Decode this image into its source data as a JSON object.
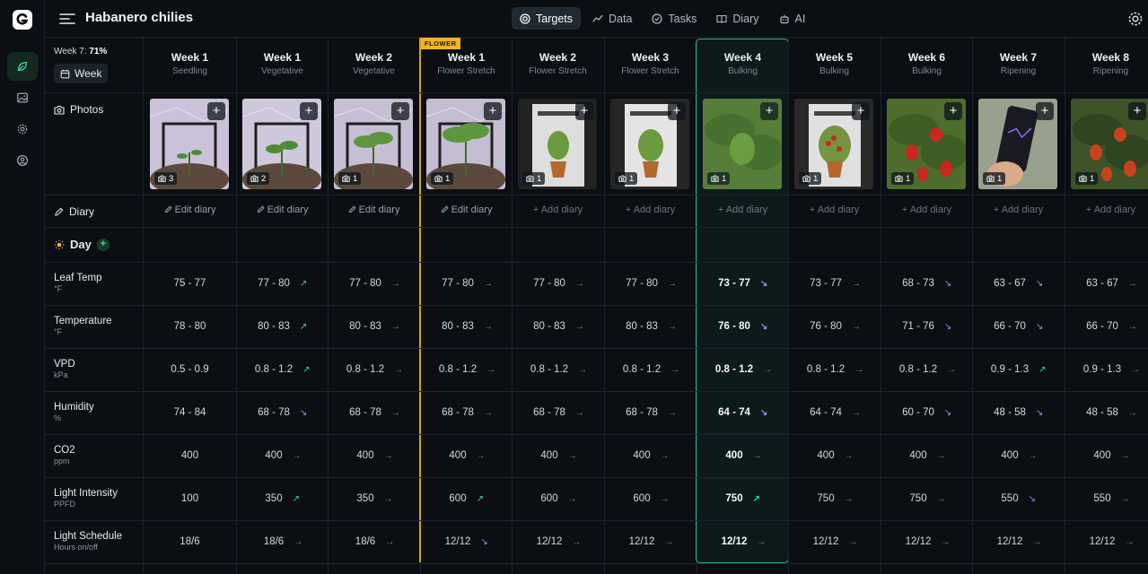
{
  "app": {
    "title": "Habanero chilies"
  },
  "nav": [
    {
      "label": "Targets",
      "icon": "target-icon",
      "active": true
    },
    {
      "label": "Data",
      "icon": "chart-line-icon",
      "active": false
    },
    {
      "label": "Tasks",
      "icon": "check-circle-icon",
      "active": false
    },
    {
      "label": "Diary",
      "icon": "book-icon",
      "active": false
    },
    {
      "label": "AI",
      "icon": "robot-icon",
      "active": false
    }
  ],
  "sidebar": {
    "week_indicator_prefix": "Week 7:",
    "week_indicator_pct": "71%",
    "week_button": "Week",
    "photos_label": "Photos",
    "diary_label": "Diary",
    "day_label": "Day",
    "flower_badge": "FLOWER"
  },
  "rows": [
    {
      "label": "Leaf Temp",
      "unit": "°F"
    },
    {
      "label": "Temperature",
      "unit": "°F"
    },
    {
      "label": "VPD",
      "unit": "kPa"
    },
    {
      "label": "Humidity",
      "unit": "%"
    },
    {
      "label": "CO2",
      "unit": "ppm"
    },
    {
      "label": "Light Intensity",
      "unit": "PPFD"
    },
    {
      "label": "Light Schedule",
      "unit": "Hours on/off"
    }
  ],
  "columns": [
    {
      "week": "Week 1",
      "stage": "Seedling",
      "photos": "3",
      "diary": "Edit diary",
      "values": [
        [
          "75 - 77",
          ""
        ],
        [
          "78 - 80",
          ""
        ],
        [
          "0.5 - 0.9",
          ""
        ],
        [
          "74 - 84",
          ""
        ],
        [
          "400",
          ""
        ],
        [
          "100",
          ""
        ],
        [
          "18/6",
          ""
        ]
      ]
    },
    {
      "week": "Week 1",
      "stage": "Vegetative",
      "photos": "2",
      "diary": "Edit diary",
      "values": [
        [
          "77 - 80",
          "up"
        ],
        [
          "80 - 83",
          "up"
        ],
        [
          "0.8 - 1.2",
          "up"
        ],
        [
          "68 - 78",
          "down"
        ],
        [
          "400",
          "flat"
        ],
        [
          "350",
          "up"
        ],
        [
          "18/6",
          "flat"
        ]
      ]
    },
    {
      "week": "Week 2",
      "stage": "Vegetative",
      "photos": "1",
      "diary": "Edit diary",
      "values": [
        [
          "77 - 80",
          "flat"
        ],
        [
          "80 - 83",
          "flat"
        ],
        [
          "0.8 - 1.2",
          "flat"
        ],
        [
          "68 - 78",
          "flat"
        ],
        [
          "400",
          "flat"
        ],
        [
          "350",
          "flat"
        ],
        [
          "18/6",
          "flat"
        ]
      ]
    },
    {
      "week": "Week 1",
      "stage": "Flower Stretch",
      "photos": "1",
      "diary": "Edit diary",
      "values": [
        [
          "77 - 80",
          "flat"
        ],
        [
          "80 - 83",
          "flat"
        ],
        [
          "0.8 - 1.2",
          "flat"
        ],
        [
          "68 - 78",
          "flat"
        ],
        [
          "400",
          "flat"
        ],
        [
          "600",
          "up"
        ],
        [
          "12/12",
          "down"
        ]
      ]
    },
    {
      "week": "Week 2",
      "stage": "Flower Stretch",
      "photos": "1",
      "diary": "Add diary",
      "values": [
        [
          "77 - 80",
          "flat"
        ],
        [
          "80 - 83",
          "flat"
        ],
        [
          "0.8 - 1.2",
          "flat"
        ],
        [
          "68 - 78",
          "flat"
        ],
        [
          "400",
          "flat"
        ],
        [
          "600",
          "flat"
        ],
        [
          "12/12",
          "flat"
        ]
      ]
    },
    {
      "week": "Week 3",
      "stage": "Flower Stretch",
      "photos": "1",
      "diary": "Add diary",
      "values": [
        [
          "77 - 80",
          "flat"
        ],
        [
          "80 - 83",
          "flat"
        ],
        [
          "0.8 - 1.2",
          "flat"
        ],
        [
          "68 - 78",
          "flat"
        ],
        [
          "400",
          "flat"
        ],
        [
          "600",
          "flat"
        ],
        [
          "12/12",
          "flat"
        ]
      ]
    },
    {
      "week": "Week 4",
      "stage": "Bulking",
      "photos": "1",
      "diary": "Add diary",
      "current": true,
      "values": [
        [
          "73 - 77",
          "down"
        ],
        [
          "76 - 80",
          "down"
        ],
        [
          "0.8 - 1.2",
          "flat"
        ],
        [
          "64 - 74",
          "down"
        ],
        [
          "400",
          "flat"
        ],
        [
          "750",
          "up"
        ],
        [
          "12/12",
          "flat"
        ]
      ]
    },
    {
      "week": "Week 5",
      "stage": "Bulking",
      "photos": "1",
      "diary": "Add diary",
      "values": [
        [
          "73 - 77",
          "flat"
        ],
        [
          "76 - 80",
          "flat"
        ],
        [
          "0.8 - 1.2",
          "flat"
        ],
        [
          "64 - 74",
          "flat"
        ],
        [
          "400",
          "flat"
        ],
        [
          "750",
          "flat"
        ],
        [
          "12/12",
          "flat"
        ]
      ]
    },
    {
      "week": "Week 6",
      "stage": "Bulking",
      "photos": "1",
      "diary": "Add diary",
      "values": [
        [
          "68 - 73",
          "down"
        ],
        [
          "71 - 76",
          "down"
        ],
        [
          "0.8 - 1.2",
          "flat"
        ],
        [
          "60 - 70",
          "down"
        ],
        [
          "400",
          "flat"
        ],
        [
          "750",
          "flat"
        ],
        [
          "12/12",
          "flat"
        ]
      ]
    },
    {
      "week": "Week 7",
      "stage": "Ripening",
      "photos": "1",
      "diary": "Add diary",
      "values": [
        [
          "63 - 67",
          "down"
        ],
        [
          "66 - 70",
          "down"
        ],
        [
          "0.9 - 1.3",
          "up"
        ],
        [
          "48 - 58",
          "down"
        ],
        [
          "400",
          "flat"
        ],
        [
          "550",
          "down"
        ],
        [
          "12/12",
          "flat"
        ]
      ]
    },
    {
      "week": "Week 8",
      "stage": "Ripening",
      "photos": "1",
      "diary": "Add diary",
      "values": [
        [
          "63 - 67",
          "flat"
        ],
        [
          "66 - 70",
          "flat"
        ],
        [
          "0.9 - 1.3",
          "flat"
        ],
        [
          "48 - 58",
          "flat"
        ],
        [
          "400",
          "flat"
        ],
        [
          "550",
          "flat"
        ],
        [
          "12/12",
          "flat"
        ]
      ]
    }
  ],
  "colors": {
    "accent": "#2fb586",
    "flower": "#f0b429",
    "trend_up": "#3ddc97",
    "trend_down": "#a48bf2"
  }
}
